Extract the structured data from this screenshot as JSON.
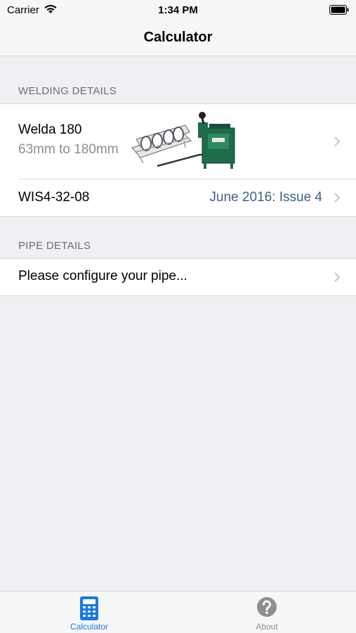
{
  "status_bar": {
    "carrier": "Carrier",
    "time": "1:34 PM"
  },
  "nav": {
    "title": "Calculator"
  },
  "welding_details": {
    "header": "WELDING DETAILS",
    "machine_name": "Welda 180",
    "machine_range": "63mm to 180mm",
    "wis_code": "WIS4-32-08",
    "wis_issue": "June 2016: Issue 4"
  },
  "pipe_details": {
    "header": "PIPE DETAILS",
    "prompt": "Please configure your pipe..."
  },
  "tab_bar": {
    "tabs": [
      {
        "label": "Calculator",
        "icon": "calculator-icon",
        "selected": true
      },
      {
        "label": "About",
        "icon": "question-icon",
        "selected": false
      }
    ]
  },
  "colors": {
    "accent": "#1a78e6",
    "link_text": "#3e5f8a",
    "secondary_text": "#8e8e93",
    "background": "#efeff4",
    "machine_green": "#1f6b4a"
  }
}
